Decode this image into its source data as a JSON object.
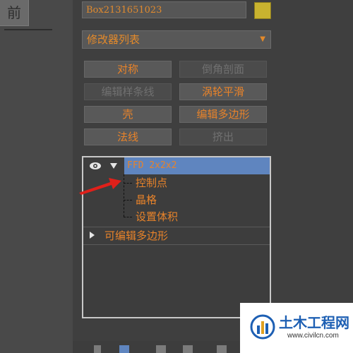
{
  "viewport": {
    "label": "前"
  },
  "object": {
    "name": "Box2131651023",
    "color": "#c9b32f"
  },
  "modifier_list": {
    "label": "修改器列表",
    "arrow": "▼"
  },
  "buttons": [
    {
      "label": "对称",
      "enabled": true
    },
    {
      "label": "倒角剖面",
      "enabled": false
    },
    {
      "label": "编辑样条线",
      "enabled": false
    },
    {
      "label": "涡轮平滑",
      "enabled": true
    },
    {
      "label": "壳",
      "enabled": true
    },
    {
      "label": "编辑多边形",
      "enabled": true
    },
    {
      "label": "法线",
      "enabled": true
    },
    {
      "label": "挤出",
      "enabled": false
    }
  ],
  "stack": {
    "top_item": "FFD 2x2x2",
    "sub_items": [
      "控制点",
      "晶格",
      "设置体积"
    ],
    "base_item": "可编辑多边形"
  },
  "watermark": {
    "title": "土木工程网",
    "url": "www.civilcn.com"
  },
  "colors": {
    "accent": "#e8832a",
    "selected": "#5f85bf"
  }
}
